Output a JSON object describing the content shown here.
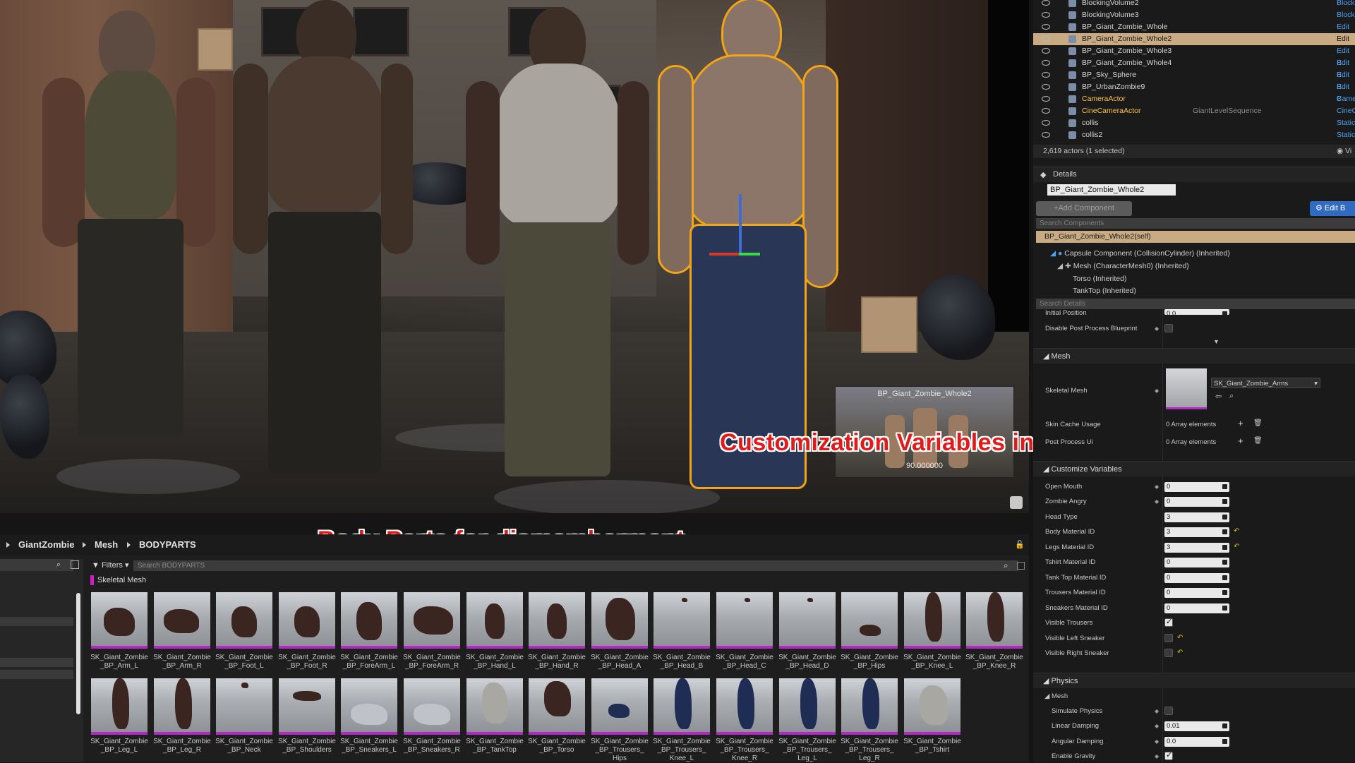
{
  "outliner": {
    "rows": [
      {
        "name": "BlockingVolume2",
        "type": "",
        "edit": "Block"
      },
      {
        "name": "BlockingVolume3",
        "type": "",
        "edit": "Block"
      },
      {
        "name": "BP_Giant_Zombie_Whole",
        "type": "",
        "edit": "Edit B"
      },
      {
        "name": "BP_Giant_Zombie_Whole2",
        "type": "",
        "edit": "Edit B",
        "selected": true
      },
      {
        "name": "BP_Giant_Zombie_Whole3",
        "type": "",
        "edit": "Edit B"
      },
      {
        "name": "BP_Giant_Zombie_Whole4",
        "type": "",
        "edit": "Edit B"
      },
      {
        "name": "BP_Sky_Sphere",
        "type": "",
        "edit": "Edit B"
      },
      {
        "name": "BP_UrbanZombie9",
        "type": "",
        "edit": "Edit B"
      },
      {
        "name": "CameraActor",
        "type": "",
        "edit": "Came"
      },
      {
        "name": "CineCameraActor",
        "type": "GiantLevelSequence",
        "edit": "CineC"
      },
      {
        "name": "collis",
        "type": "",
        "edit": "Static"
      },
      {
        "name": "collis2",
        "type": "",
        "edit": "Static"
      }
    ],
    "footer": "2,619 actors (1 selected)",
    "view_label": "Vi"
  },
  "details": {
    "tab": "Details",
    "actor_name": "BP_Giant_Zombie_Whole2",
    "add_component": "+Add Component",
    "edit_bp": "Edit B",
    "search_components": "Search Components",
    "self": "BP_Giant_Zombie_Whole2(self)",
    "tree": [
      "Capsule Component (CollisionCylinder) (Inherited)",
      "Mesh (CharacterMesh0) (Inherited)",
      "Torso (Inherited)",
      "TankTop (Inherited)"
    ],
    "search_details": "Search Details",
    "initial_position_label": "Initial Position",
    "initial_position": "0.0",
    "disable_pp_label": "Disable Post Process Blueprint",
    "mesh_section": "Mesh",
    "skeletal_mesh_label": "Skeletal Mesh",
    "skeletal_mesh_value": "SK_Giant_Zombie_Arms",
    "skin_cache_label": "Skin Cache Usage",
    "skin_cache_value": "0 Array elements",
    "postprocess_label": "Post Process Ui",
    "postprocess_value": "0 Array elements",
    "customize_section": "Customize Variables",
    "customize": [
      {
        "label": "Open Mouth",
        "value": "0"
      },
      {
        "label": "Zombie Angry",
        "value": "0"
      },
      {
        "label": "Head Type",
        "value": "3"
      },
      {
        "label": "Body Material ID",
        "value": "3"
      },
      {
        "label": "Legs Material ID",
        "value": "3"
      },
      {
        "label": "Tshirt Material ID",
        "value": "0"
      },
      {
        "label": "Tank Top Material ID",
        "value": "0"
      },
      {
        "label": "Trousers Material ID",
        "value": "0"
      },
      {
        "label": "Sneakers Material ID",
        "value": "0"
      },
      {
        "label": "Visible Trousers",
        "value": ""
      },
      {
        "label": "Visible Left Sneaker",
        "value": ""
      },
      {
        "label": "Visible Right Sneaker",
        "value": ""
      }
    ],
    "physics_section": "Physics",
    "physics_sub": "Mesh",
    "physics": [
      {
        "label": "Simulate Physics",
        "value": ""
      },
      {
        "label": "Linear Damping",
        "value": "0.01"
      },
      {
        "label": "Angular Damping",
        "value": "0.0"
      },
      {
        "label": "Enable Gravity",
        "value": ""
      }
    ]
  },
  "viewport": {
    "pip_title": "BP_Giant_Zombie_Whole2",
    "pip_value": "90.000000"
  },
  "annotations": {
    "custom_vars": "Customization Variables in the BP",
    "body_parts": "Body Parts for dismemberment"
  },
  "content_browser": {
    "breadcrumb": [
      "GiantZombie",
      "Mesh",
      "BODYPARTS"
    ],
    "filters": "Filters",
    "search_placeholder": "Search BODYPARTS",
    "category": "Skeletal Mesh",
    "row1": [
      [
        "SK_Giant_Zombie",
        "_BP_Arm_L"
      ],
      [
        "SK_Giant_Zombie",
        "_BP_Arm_R"
      ],
      [
        "SK_Giant_Zombie",
        "_BP_Foot_L"
      ],
      [
        "SK_Giant_Zombie",
        "_BP_Foot_R"
      ],
      [
        "SK_Giant_Zombie",
        "_BP_ForeArm_L"
      ],
      [
        "SK_Giant_Zombie",
        "_BP_ForeArm_R"
      ],
      [
        "SK_Giant_Zombie",
        "_BP_Hand_L"
      ],
      [
        "SK_Giant_Zombie",
        "_BP_Hand_R"
      ],
      [
        "SK_Giant_Zombie",
        "_BP_Head_A"
      ],
      [
        "SK_Giant_Zombie",
        "_BP_Head_B"
      ],
      [
        "SK_Giant_Zombie",
        "_BP_Head_C"
      ],
      [
        "SK_Giant_Zombie",
        "_BP_Head_D"
      ],
      [
        "SK_Giant_Zombie",
        "_BP_Hips"
      ],
      [
        "SK_Giant_Zombie",
        "_BP_Knee_L"
      ],
      [
        "SK_Giant_Zombie",
        "_BP_Knee_R"
      ]
    ],
    "row2": [
      [
        "SK_Giant_Zombie",
        "_BP_Leg_L"
      ],
      [
        "SK_Giant_Zombie",
        "_BP_Leg_R"
      ],
      [
        "SK_Giant_Zombie",
        "_BP_Neck"
      ],
      [
        "SK_Giant_Zombie",
        "_BP_Shoulders"
      ],
      [
        "SK_Giant_Zombie",
        "_BP_Sneakers_L"
      ],
      [
        "SK_Giant_Zombie",
        "_BP_Sneakers_R"
      ],
      [
        "SK_Giant_Zombie",
        "_BP_TankTop"
      ],
      [
        "SK_Giant_Zombie",
        "_BP_Torso"
      ],
      [
        "SK_Giant_Zombie",
        "_BP_Trousers_",
        "Hips"
      ],
      [
        "SK_Giant_Zombie",
        "_BP_Trousers_",
        "Knee_L"
      ],
      [
        "SK_Giant_Zombie",
        "_BP_Trousers_",
        "Knee_R"
      ],
      [
        "SK_Giant_Zombie",
        "_BP_Trousers_",
        "Leg_L"
      ],
      [
        "SK_Giant_Zombie",
        "_BP_Trousers_",
        "Leg_R"
      ],
      [
        "SK_Giant_Zombie",
        "_BP_Tshirt"
      ]
    ]
  },
  "colors": {
    "selection": "#c8ab82",
    "selection_outline": "#f2a516",
    "accent_blue": "#2f6bc2",
    "skeletal_mesh_tag": "#d21cc8",
    "annotation_red": "#e11a1a"
  }
}
